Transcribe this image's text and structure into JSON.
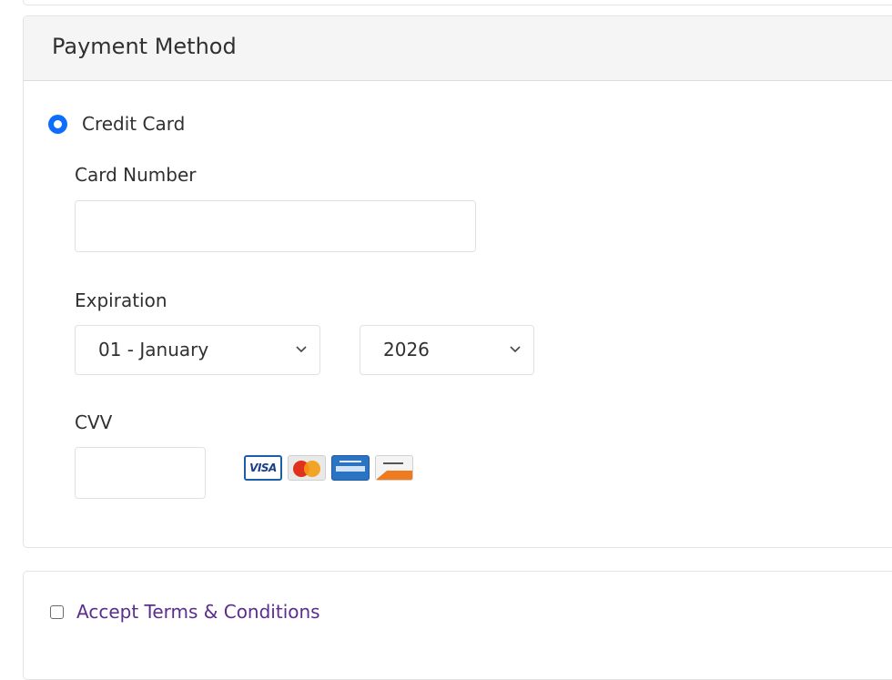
{
  "payment_section": {
    "title": "Payment Method",
    "option_label": "Credit Card"
  },
  "form": {
    "card_number_label": "Card Number",
    "card_number_value": "",
    "expiration_label": "Expiration",
    "month_value": "01 - January",
    "year_value": "2026",
    "cvv_label": "CVV",
    "cvv_value": ""
  },
  "card_logos": [
    {
      "name": "visa-logo-icon",
      "text": "VISA"
    },
    {
      "name": "mastercard-logo-icon"
    },
    {
      "name": "amex-logo-icon"
    },
    {
      "name": "discover-logo-icon"
    }
  ],
  "terms": {
    "label": "Accept Terms & Conditions"
  },
  "colors": {
    "accent": "#0d6efd",
    "link": "#5b2d8e",
    "header_bg": "#f5f5f5"
  }
}
